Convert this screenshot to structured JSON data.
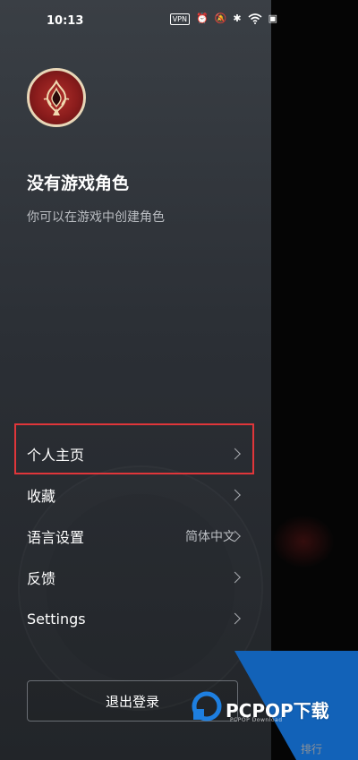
{
  "status_bar": {
    "time": "10:13",
    "vpn_label": "VPN",
    "icons": [
      "alarm-icon",
      "mute-icon",
      "bluetooth-icon",
      "wifi-icon",
      "hd-icon"
    ]
  },
  "profile": {
    "avatar_icon": "game-emblem-avatar",
    "title": "没有游戏角色",
    "subtitle": "你可以在游戏中创建角色"
  },
  "menu": {
    "items": [
      {
        "label": "个人主页",
        "value": ""
      },
      {
        "label": "收藏",
        "value": ""
      },
      {
        "label": "语言设置",
        "value": "简体中文"
      },
      {
        "label": "反馈",
        "value": ""
      },
      {
        "label": "Settings",
        "value": ""
      }
    ]
  },
  "logout_label": "退出登录",
  "watermark": {
    "brand": "PCPOP下载",
    "sub": "PCPOP Download"
  },
  "background_snippet": "排行",
  "colors": {
    "highlight_border": "#e0363a",
    "watermark_blue": "#1262b8",
    "avatar_red": "#8a1c1c"
  }
}
